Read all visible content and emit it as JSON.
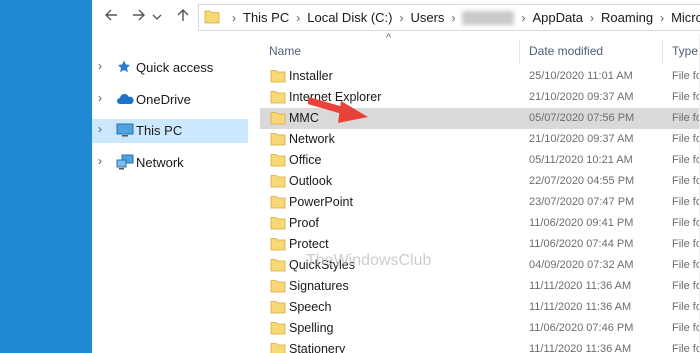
{
  "toolbar": {
    "back_icon": "arrow-left-icon",
    "forward_icon": "arrow-right-icon",
    "dropdown_icon": "chevron-down-icon",
    "up_icon": "arrow-up-icon"
  },
  "address_bar": {
    "crumbs": [
      "This PC",
      "Local Disk (C:)",
      "Users",
      "AppData",
      "Roaming",
      "Microsoft"
    ]
  },
  "nav_pane": {
    "items": [
      {
        "label": "Quick access",
        "icon": "star-icon"
      },
      {
        "label": "OneDrive",
        "icon": "cloud-icon"
      },
      {
        "label": "This PC",
        "icon": "computer-icon"
      },
      {
        "label": "Network",
        "icon": "network-icon"
      }
    ]
  },
  "columns": {
    "name": "Name",
    "date": "Date modified",
    "type": "Type"
  },
  "files": [
    {
      "name": "Installer",
      "date": "25/10/2020 11:01 AM",
      "type": "File fo"
    },
    {
      "name": "Internet Explorer",
      "date": "21/10/2020 09:37 AM",
      "type": "File fo"
    },
    {
      "name": "MMC",
      "date": "05/07/2020 07:56 PM",
      "type": "File fo"
    },
    {
      "name": "Network",
      "date": "21/10/2020 09:37 AM",
      "type": "File fo"
    },
    {
      "name": "Office",
      "date": "05/11/2020 10:21 AM",
      "type": "File fo"
    },
    {
      "name": "Outlook",
      "date": "22/07/2020 04:55 PM",
      "type": "File fo"
    },
    {
      "name": "PowerPoint",
      "date": "23/07/2020 07:47 PM",
      "type": "File fo"
    },
    {
      "name": "Proof",
      "date": "11/06/2020 09:41 PM",
      "type": "File fo"
    },
    {
      "name": "Protect",
      "date": "11/06/2020 07:44 PM",
      "type": "File fo"
    },
    {
      "name": "QuickStyles",
      "date": "04/09/2020 07:32 AM",
      "type": "File fo"
    },
    {
      "name": "Signatures",
      "date": "11/11/2020 11:36 AM",
      "type": "File fo"
    },
    {
      "name": "Speech",
      "date": "11/11/2020 11:36 AM",
      "type": "File fo"
    },
    {
      "name": "Spelling",
      "date": "11/06/2020 07:46 PM",
      "type": "File fo"
    },
    {
      "name": "Stationery",
      "date": "11/11/2020 11:36 AM",
      "type": "File fo"
    }
  ],
  "watermark": "TheWindowsClub",
  "colors": {
    "desktop": "#1e90d6",
    "selected_nav": "#cce8ff",
    "selected_row": "#d9d9d9",
    "folder": "#f8d775",
    "arrow": "#e8423a"
  }
}
